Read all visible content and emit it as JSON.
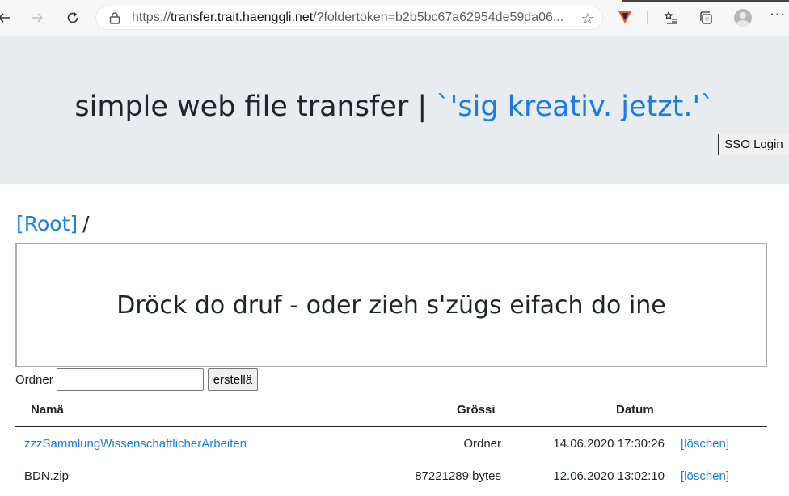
{
  "browser": {
    "url_prefix": "https://",
    "url_host": "transfer.trait.haenggli.net",
    "url_rest": "/?foldertoken=b2b5bc67a62954de59da06..."
  },
  "header": {
    "title": "simple web file transfer |",
    "tagline": "`'sig kreativ. jetzt.'`",
    "sso_label": "SSO Login"
  },
  "breadcrumb": {
    "root": "[Root]",
    "separator": "/"
  },
  "dropzone": {
    "text": "Dröck do druf - oder zieh s'zügs eifach do ine"
  },
  "folder_form": {
    "label": "Ordner",
    "input_value": "",
    "button_label": "erstellä"
  },
  "table": {
    "headers": [
      "Namä",
      "Grössi",
      "Datum"
    ],
    "rows": [
      {
        "name": "zzzSammlungWissenschaftlicherArbeiten",
        "size": "Ordner",
        "date": "14.06.2020 17:30:26",
        "action": "[löschen]"
      },
      {
        "name": "BDN.zip",
        "size": "87221289 bytes",
        "date": "12.06.2020 13:02:10",
        "action": "[löschen]"
      }
    ]
  },
  "colors": {
    "accent": "#1a7de6",
    "jumbotron_bg": "#e9ecef"
  }
}
